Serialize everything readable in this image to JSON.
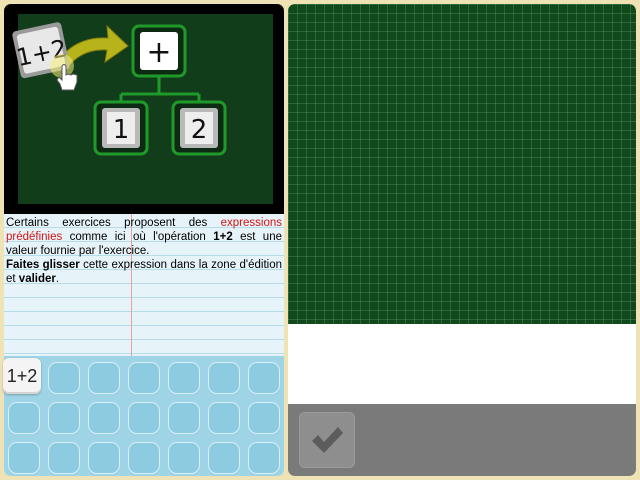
{
  "illustration": {
    "expression_chip": "1+2",
    "tree_root": "+",
    "tree_left": "1",
    "tree_right": "2"
  },
  "instructions": {
    "p1_a": "Certains exercices proposent des ",
    "p1_red": "expressions prédéfinies",
    "p1_b": " comme ici où l'opération ",
    "p1_bold": "1+2",
    "p1_c": " est une valeur fournie par l'exercice.",
    "p2_bold1": "Faites glisser",
    "p2_a": " cette expression dans la zone d'édition et ",
    "p2_bold2": "valider",
    "p2_b": "."
  },
  "tray": {
    "chip_label": "1+2"
  },
  "icons": {
    "validate": "check-icon",
    "pointer": "hand-pointer-icon",
    "arrow": "curved-arrow-icon"
  },
  "colors": {
    "board": "#123d1b",
    "grid": "#104a1c",
    "accent_arrow": "#b6b31b",
    "highlight_red": "#d31414"
  }
}
